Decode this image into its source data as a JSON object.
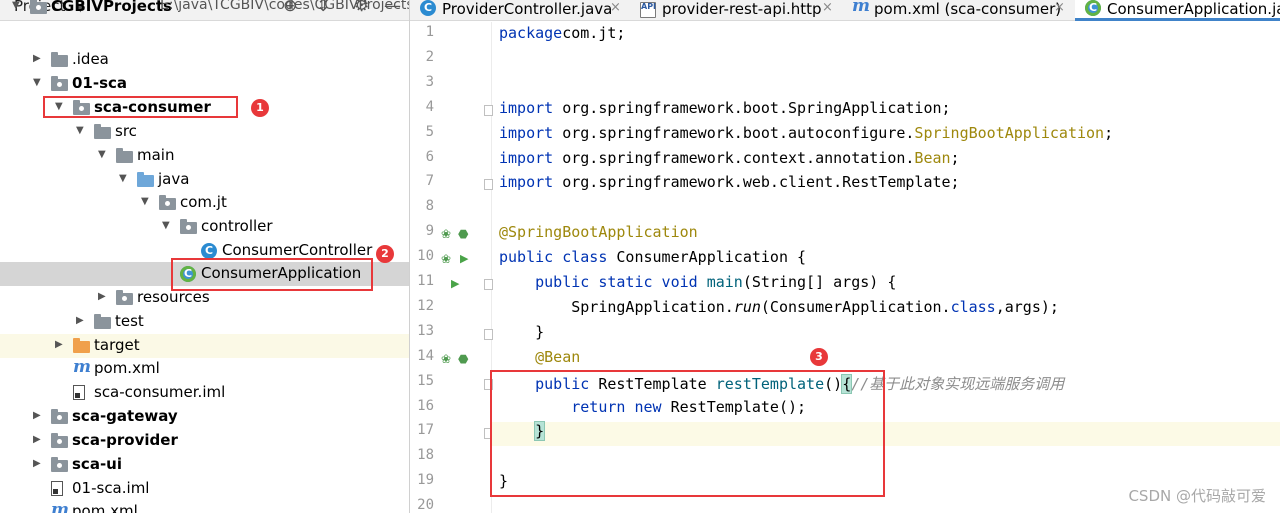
{
  "project_panel": {
    "title": "Project",
    "tree": [
      {
        "label": "CGBIVProjects",
        "path": "E:\\java\\TCGBIV\\codes\\CGBIVProjects",
        "bold": true,
        "icon": "module-folder-icon",
        "expanded": true
      },
      {
        "label": ".idea",
        "icon": "folder-icon",
        "expanded": false
      },
      {
        "label": "01-sca",
        "bold": true,
        "icon": "module-folder-icon",
        "expanded": true
      },
      {
        "label": "sca-consumer",
        "bold": true,
        "icon": "module-folder-icon",
        "expanded": true
      },
      {
        "label": "src",
        "icon": "folder-icon",
        "expanded": true
      },
      {
        "label": "main",
        "icon": "folder-icon",
        "expanded": true
      },
      {
        "label": "java",
        "icon": "source-folder-icon",
        "expanded": true
      },
      {
        "label": "com.jt",
        "icon": "package-icon",
        "expanded": true
      },
      {
        "label": "controller",
        "icon": "package-icon",
        "expanded": true
      },
      {
        "label": "ConsumerController",
        "icon": "class-icon"
      },
      {
        "label": "ConsumerApplication",
        "icon": "spring-class-icon"
      },
      {
        "label": "resources",
        "icon": "resources-folder-icon",
        "expanded": false
      },
      {
        "label": "test",
        "icon": "folder-icon",
        "expanded": false
      },
      {
        "label": "target",
        "icon": "target-folder-icon",
        "expanded": false
      },
      {
        "label": "pom.xml",
        "icon": "maven-icon"
      },
      {
        "label": "sca-consumer.iml",
        "icon": "iml-file-icon"
      },
      {
        "label": "sca-gateway",
        "bold": true,
        "icon": "module-folder-icon",
        "expanded": false
      },
      {
        "label": "sca-provider",
        "bold": true,
        "icon": "module-folder-icon",
        "expanded": false
      },
      {
        "label": "sca-ui",
        "bold": true,
        "icon": "module-folder-icon",
        "expanded": false
      },
      {
        "label": "01-sca.iml",
        "icon": "iml-file-icon"
      },
      {
        "label": "pom.xml",
        "icon": "maven-icon"
      }
    ]
  },
  "tabs": [
    {
      "label": "ProviderController.java",
      "icon": "class-icon",
      "active": false
    },
    {
      "label": "provider-rest-api.http",
      "icon": "api-file-icon",
      "active": false
    },
    {
      "label": "pom.xml (sca-consumer)",
      "icon": "maven-icon",
      "active": false
    },
    {
      "label": "ConsumerApplication.java",
      "icon": "spring-class-icon",
      "active": true
    }
  ],
  "editor": {
    "line_numbers": [
      "1",
      "2",
      "3",
      "4",
      "5",
      "6",
      "7",
      "8",
      "9",
      "10",
      "11",
      "12",
      "13",
      "14",
      "15",
      "16",
      "17",
      "18",
      "19",
      "20"
    ],
    "lines": [
      [
        [
          "kw",
          "package"
        ],
        [
          "",
          "com.jt;"
        ]
      ],
      [],
      [],
      [
        [
          "kw",
          "import"
        ],
        [
          "",
          " org.springframework.boot.SpringApplication;"
        ]
      ],
      [
        [
          "kw",
          "import"
        ],
        [
          "",
          " org.springframework.boot.autoconfigure."
        ],
        [
          "ann",
          "SpringBootApplication"
        ],
        [
          "",
          ";"
        ]
      ],
      [
        [
          "kw",
          "import"
        ],
        [
          "",
          " org.springframework.context.annotation."
        ],
        [
          "ann",
          "Bean"
        ],
        [
          "",
          ";"
        ]
      ],
      [
        [
          "kw",
          "import"
        ],
        [
          "",
          " org.springframework.web.client.RestTemplate;"
        ]
      ],
      [],
      [
        [
          "ann",
          "@SpringBootApplication"
        ]
      ],
      [
        [
          "kw",
          "public class"
        ],
        [
          "",
          " ConsumerApplication {"
        ]
      ],
      [
        [
          "",
          "    "
        ],
        [
          "kw",
          "public static void"
        ],
        [
          "fn",
          " main"
        ],
        [
          "",
          "(String[] args) {"
        ]
      ],
      [
        [
          "",
          "        SpringApplication."
        ],
        [
          "ital",
          "run"
        ],
        [
          "",
          "(ConsumerApplication."
        ],
        [
          "kw",
          "class"
        ],
        [
          "",
          ",args);"
        ]
      ],
      [
        [
          "",
          "    }"
        ]
      ],
      [
        [
          "",
          "    "
        ],
        [
          "ann",
          "@Bean"
        ]
      ],
      [
        [
          "",
          "    "
        ],
        [
          "kw",
          "public"
        ],
        [
          "",
          " RestTemplate "
        ],
        [
          "fn",
          "restTemplate"
        ],
        [
          "",
          "()"
        ],
        [
          "brace",
          "{"
        ],
        [
          "cmt",
          "//基于此对象实现远端服务调用"
        ]
      ],
      [
        [
          "",
          "        "
        ],
        [
          "kw",
          "return new"
        ],
        [
          "",
          " RestTemplate();"
        ]
      ],
      [
        [
          "",
          "    "
        ],
        [
          "brace",
          "}"
        ]
      ],
      [],
      [
        [
          "",
          "}"
        ]
      ],
      []
    ]
  },
  "annotations": {
    "badge_1": "1",
    "badge_2": "2",
    "badge_3": "3"
  },
  "watermark": "CSDN @代码敲可爱",
  "colors": {
    "keyword": "#0033b3",
    "annotation": "#9e880d",
    "comment": "#8c8c8c",
    "method": "#00627a",
    "highlight_box": "#e8383a",
    "selection": "#d5d5d5"
  }
}
